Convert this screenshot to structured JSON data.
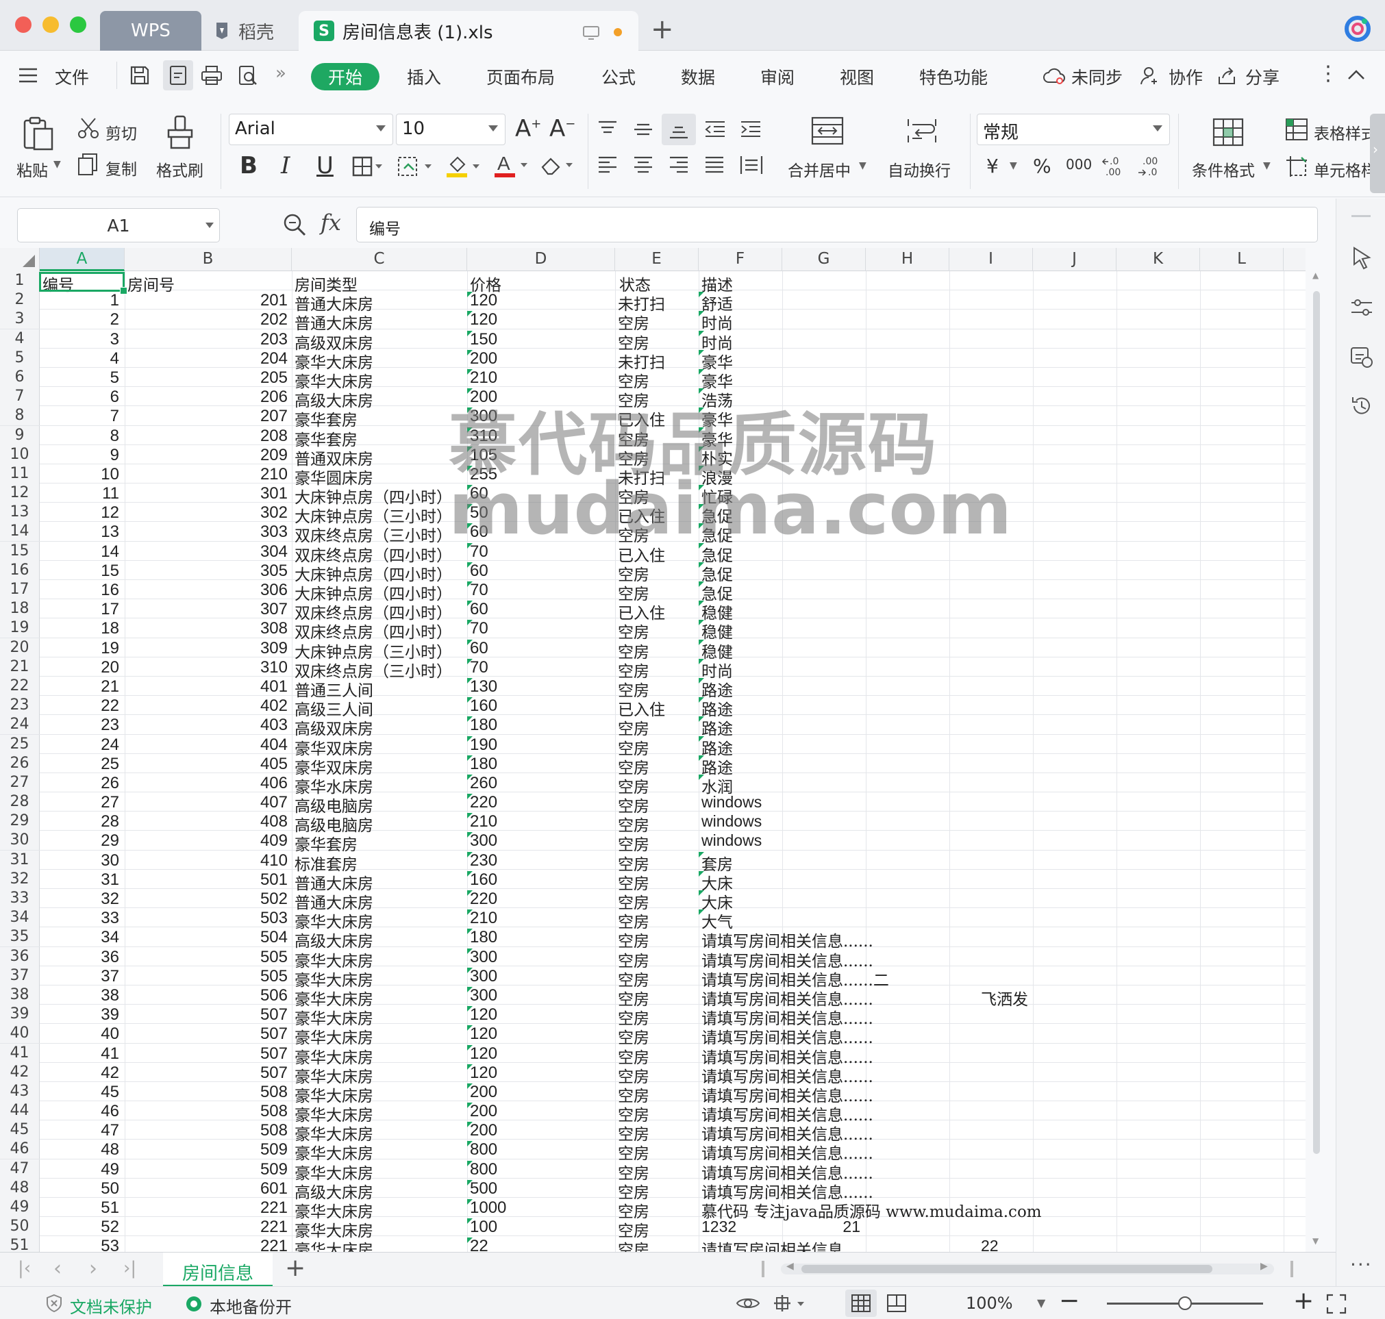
{
  "window": {
    "tabs": [
      {
        "label": "WPS"
      },
      {
        "label": "稻壳"
      },
      {
        "label": "房间信息表 (1).xls"
      }
    ]
  },
  "menu": {
    "file": "文件",
    "tabs": [
      "开始",
      "插入",
      "页面布局",
      "公式",
      "数据",
      "审阅",
      "视图",
      "特色功能"
    ],
    "sync": "未同步",
    "collab": "协作",
    "share": "分享"
  },
  "ribbon": {
    "paste": "粘贴",
    "cut": "剪切",
    "copy": "复制",
    "format_painter": "格式刷",
    "font_name": "Arial",
    "font_size": "10",
    "merge_center": "合并居中",
    "wrap": "自动换行",
    "number_format": "常规",
    "conditional_format": "条件格式",
    "table_style": "表格样式",
    "cell_style": "单元格样式",
    "currency_symbol": "¥",
    "percent_symbol": "%",
    "thousands_symbol": "000"
  },
  "formula_bar": {
    "cell_ref": "A1",
    "fx": "fx",
    "value": "编号"
  },
  "columns": [
    "A",
    "B",
    "C",
    "D",
    "E",
    "F",
    "G",
    "H",
    "I",
    "J",
    "K",
    "L"
  ],
  "header_row": {
    "n": "1",
    "a": "编号",
    "b": "房间号",
    "c": "房间类型",
    "d": "价格",
    "e": "状态",
    "f": "描述"
  },
  "rows": [
    {
      "n": "2",
      "a": "1",
      "b": "201",
      "c": "普通大床房",
      "d": "120",
      "e": "未打扫",
      "f": "舒适"
    },
    {
      "n": "3",
      "a": "2",
      "b": "202",
      "c": "普通大床房",
      "d": "120",
      "e": "空房",
      "f": "时尚"
    },
    {
      "n": "4",
      "a": "3",
      "b": "203",
      "c": "高级双床房",
      "d": "150",
      "e": "空房",
      "f": "时尚"
    },
    {
      "n": "5",
      "a": "4",
      "b": "204",
      "c": "豪华大床房",
      "d": "200",
      "e": "未打扫",
      "f": "豪华"
    },
    {
      "n": "6",
      "a": "5",
      "b": "205",
      "c": "豪华大床房",
      "d": "210",
      "e": "空房",
      "f": "豪华"
    },
    {
      "n": "7",
      "a": "6",
      "b": "206",
      "c": "高级大床房",
      "d": "200",
      "e": "空房",
      "f": "浩荡"
    },
    {
      "n": "8",
      "a": "7",
      "b": "207",
      "c": "豪华套房",
      "d": "300",
      "e": "已入住",
      "f": "豪华"
    },
    {
      "n": "9",
      "a": "8",
      "b": "208",
      "c": "豪华套房",
      "d": "310",
      "e": "空房",
      "f": "豪华"
    },
    {
      "n": "10",
      "a": "9",
      "b": "209",
      "c": "普通双床房",
      "d": "105",
      "e": "空房",
      "f": "朴实"
    },
    {
      "n": "11",
      "a": "10",
      "b": "210",
      "c": "豪华圆床房",
      "d": "255",
      "e": "未打扫",
      "f": "浪漫"
    },
    {
      "n": "12",
      "a": "11",
      "b": "301",
      "c": "大床钟点房（四小时）",
      "d": "60",
      "e": "空房",
      "f": "忙碌"
    },
    {
      "n": "13",
      "a": "12",
      "b": "302",
      "c": "大床钟点房（三小时）",
      "d": "50",
      "e": "已入住",
      "f": "急促"
    },
    {
      "n": "14",
      "a": "13",
      "b": "303",
      "c": "双床终点房（三小时）",
      "d": "60",
      "e": "空房",
      "f": "急促"
    },
    {
      "n": "15",
      "a": "14",
      "b": "304",
      "c": "双床终点房（四小时）",
      "d": "70",
      "e": "已入住",
      "f": "急促"
    },
    {
      "n": "16",
      "a": "15",
      "b": "305",
      "c": "大床钟点房（四小时）",
      "d": "60",
      "e": "空房",
      "f": "急促"
    },
    {
      "n": "17",
      "a": "16",
      "b": "306",
      "c": "大床钟点房（四小时）",
      "d": "70",
      "e": "空房",
      "f": "急促"
    },
    {
      "n": "18",
      "a": "17",
      "b": "307",
      "c": "双床终点房（四小时）",
      "d": "60",
      "e": "已入住",
      "f": "稳健"
    },
    {
      "n": "19",
      "a": "18",
      "b": "308",
      "c": "双床终点房（四小时）",
      "d": "70",
      "e": "空房",
      "f": "稳健"
    },
    {
      "n": "20",
      "a": "19",
      "b": "309",
      "c": "大床钟点房（三小时）",
      "d": "60",
      "e": "空房",
      "f": "稳健"
    },
    {
      "n": "21",
      "a": "20",
      "b": "310",
      "c": "双床终点房（三小时）",
      "d": "70",
      "e": "空房",
      "f": "时尚"
    },
    {
      "n": "22",
      "a": "21",
      "b": "401",
      "c": "普通三人间",
      "d": "130",
      "e": "空房",
      "f": "路途"
    },
    {
      "n": "23",
      "a": "22",
      "b": "402",
      "c": "高级三人间",
      "d": "160",
      "e": "已入住",
      "f": "路途"
    },
    {
      "n": "24",
      "a": "23",
      "b": "403",
      "c": "高级双床房",
      "d": "180",
      "e": "空房",
      "f": "路途"
    },
    {
      "n": "25",
      "a": "24",
      "b": "404",
      "c": "豪华双床房",
      "d": "190",
      "e": "空房",
      "f": "路途"
    },
    {
      "n": "26",
      "a": "25",
      "b": "405",
      "c": "豪华双床房",
      "d": "180",
      "e": "空房",
      "f": "路途"
    },
    {
      "n": "27",
      "a": "26",
      "b": "406",
      "c": "豪华水床房",
      "d": "260",
      "e": "空房",
      "f": "水润"
    },
    {
      "n": "28",
      "a": "27",
      "b": "407",
      "c": "高级电脑房",
      "d": "220",
      "e": "空房",
      "f": "windows"
    },
    {
      "n": "29",
      "a": "28",
      "b": "408",
      "c": "高级电脑房",
      "d": "210",
      "e": "空房",
      "f": "windows"
    },
    {
      "n": "30",
      "a": "29",
      "b": "409",
      "c": "豪华套房",
      "d": "300",
      "e": "空房",
      "f": "windows"
    },
    {
      "n": "31",
      "a": "30",
      "b": "410",
      "c": "标准套房",
      "d": "230",
      "e": "空房",
      "f": "套房"
    },
    {
      "n": "32",
      "a": "31",
      "b": "501",
      "c": "普通大床房",
      "d": "160",
      "e": "空房",
      "f": "大床"
    },
    {
      "n": "33",
      "a": "32",
      "b": "502",
      "c": "普通大床房",
      "d": "220",
      "e": "空房",
      "f": "大床"
    },
    {
      "n": "34",
      "a": "33",
      "b": "503",
      "c": "豪华大床房",
      "d": "210",
      "e": "空房",
      "f": "大气"
    },
    {
      "n": "35",
      "a": "34",
      "b": "504",
      "c": "高级大床房",
      "d": "180",
      "e": "空房",
      "f": "请填写房间相关信息......"
    },
    {
      "n": "36",
      "a": "36",
      "b": "505",
      "c": "豪华大床房",
      "d": "300",
      "e": "空房",
      "f": "请填写房间相关信息......"
    },
    {
      "n": "37",
      "a": "37",
      "b": "505",
      "c": "豪华大床房",
      "d": "300",
      "e": "空房",
      "f": "请填写房间相关信息......二"
    },
    {
      "n": "38",
      "a": "38",
      "b": "506",
      "c": "豪华大床房",
      "d": "300",
      "e": "空房",
      "f": "请填写房间相关信息......",
      "i": "飞洒发"
    },
    {
      "n": "39",
      "a": "39",
      "b": "507",
      "c": "豪华大床房",
      "d": "120",
      "e": "空房",
      "f": "请填写房间相关信息......"
    },
    {
      "n": "40",
      "a": "40",
      "b": "507",
      "c": "豪华大床房",
      "d": "120",
      "e": "空房",
      "f": "请填写房间相关信息......"
    },
    {
      "n": "41",
      "a": "41",
      "b": "507",
      "c": "豪华大床房",
      "d": "120",
      "e": "空房",
      "f": "请填写房间相关信息......"
    },
    {
      "n": "42",
      "a": "42",
      "b": "507",
      "c": "豪华大床房",
      "d": "120",
      "e": "空房",
      "f": "请填写房间相关信息......"
    },
    {
      "n": "43",
      "a": "45",
      "b": "508",
      "c": "豪华大床房",
      "d": "200",
      "e": "空房",
      "f": "请填写房间相关信息......"
    },
    {
      "n": "44",
      "a": "46",
      "b": "508",
      "c": "豪华大床房",
      "d": "200",
      "e": "空房",
      "f": "请填写房间相关信息......"
    },
    {
      "n": "45",
      "a": "47",
      "b": "508",
      "c": "豪华大床房",
      "d": "200",
      "e": "空房",
      "f": "请填写房间相关信息......"
    },
    {
      "n": "46",
      "a": "48",
      "b": "509",
      "c": "豪华大床房",
      "d": "800",
      "e": "空房",
      "f": "请填写房间相关信息......"
    },
    {
      "n": "47",
      "a": "49",
      "b": "509",
      "c": "豪华大床房",
      "d": "800",
      "e": "空房",
      "f": "请填写房间相关信息......"
    },
    {
      "n": "48",
      "a": "50",
      "b": "601",
      "c": "高级大床房",
      "d": "500",
      "e": "空房",
      "f": "请填写房间相关信息......"
    },
    {
      "n": "49",
      "a": "51",
      "b": "221",
      "c": "豪华大床房",
      "d": "1000",
      "e": "空房",
      "f": "慕代码 专注java品质源码 www.mudaima.com"
    },
    {
      "n": "50",
      "a": "52",
      "b": "221",
      "c": "豪华大床房",
      "d": "100",
      "e": "空房",
      "f": "1232",
      "g": "21"
    },
    {
      "n": "51",
      "a": "53",
      "b": "221",
      "c": "豪华大床房",
      "d": "22",
      "e": "空房",
      "f": "请填写房间相关信息......",
      "i": "22"
    }
  ],
  "watermark": {
    "line1": "慕代码品质源码",
    "line2": "mudaima.com"
  },
  "sheet_tabs": [
    "房间信息"
  ],
  "status": {
    "protect": "文档未保护",
    "backup": "本地备份开",
    "zoom": "100%"
  }
}
